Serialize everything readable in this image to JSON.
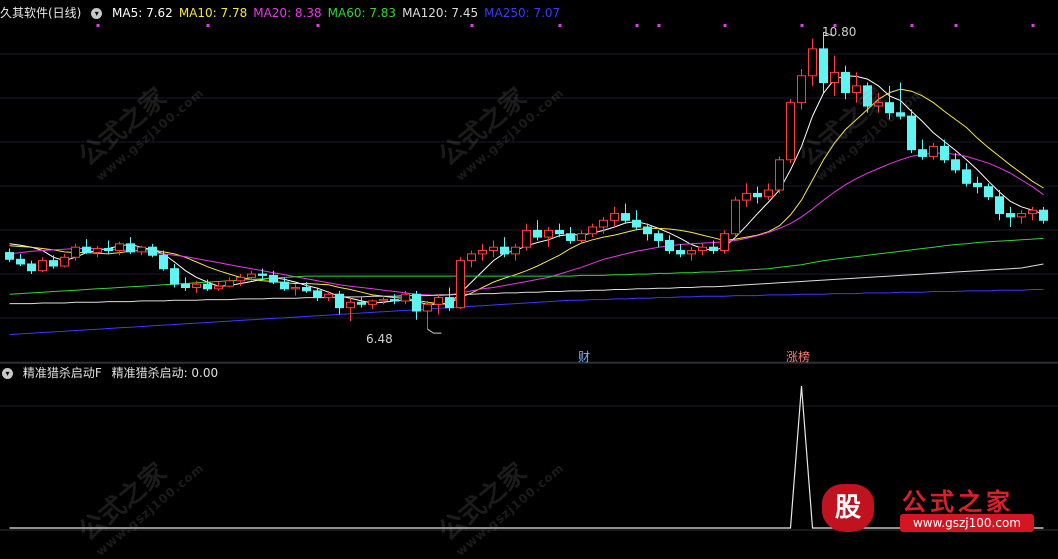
{
  "header": {
    "title": "久其软件(日线)",
    "ma": [
      {
        "label": "MA5: 7.62",
        "color": "#ffffff"
      },
      {
        "label": "MA10: 7.78",
        "color": "#f5e642"
      },
      {
        "label": "MA20: 8.38",
        "color": "#e83ae8"
      },
      {
        "label": "MA60: 7.83",
        "color": "#33d433"
      },
      {
        "label": "MA120: 7.45",
        "color": "#dcdcdc"
      },
      {
        "label": "MA250: 7.07",
        "color": "#3a3aff"
      }
    ]
  },
  "price_chart": {
    "high_label": "10.80",
    "low_label": "6.48",
    "markers": {
      "cai": "财",
      "zhangbang": "涨榜"
    },
    "up_color": "#ff3d3d",
    "down_color": "#5ff5f5"
  },
  "indicator": {
    "name": "精准猎杀启动F",
    "value_label": "精准猎杀启动: 0.00"
  },
  "watermark": {
    "text": "公式之家",
    "url": "www.gszj100.com"
  },
  "logo": {
    "char": "股",
    "title": "公式之家",
    "url": "www.gszj100.com"
  },
  "chart_data": {
    "type": "candlestick",
    "ohlc": [
      [
        7.62,
        7.68,
        7.48,
        7.52
      ],
      [
        7.52,
        7.6,
        7.42,
        7.45
      ],
      [
        7.45,
        7.5,
        7.3,
        7.35
      ],
      [
        7.35,
        7.55,
        7.33,
        7.5
      ],
      [
        7.5,
        7.58,
        7.38,
        7.42
      ],
      [
        7.42,
        7.6,
        7.4,
        7.55
      ],
      [
        7.55,
        7.75,
        7.5,
        7.7
      ],
      [
        7.7,
        7.82,
        7.6,
        7.62
      ],
      [
        7.62,
        7.72,
        7.55,
        7.68
      ],
      [
        7.68,
        7.8,
        7.6,
        7.65
      ],
      [
        7.65,
        7.78,
        7.58,
        7.75
      ],
      [
        7.75,
        7.85,
        7.6,
        7.63
      ],
      [
        7.63,
        7.72,
        7.58,
        7.7
      ],
      [
        7.7,
        7.75,
        7.55,
        7.58
      ],
      [
        7.58,
        7.65,
        7.35,
        7.38
      ],
      [
        7.38,
        7.45,
        7.1,
        7.15
      ],
      [
        7.15,
        7.25,
        7.05,
        7.1
      ],
      [
        7.1,
        7.2,
        7.02,
        7.15
      ],
      [
        7.15,
        7.22,
        7.05,
        7.08
      ],
      [
        7.08,
        7.18,
        7.05,
        7.12
      ],
      [
        7.12,
        7.25,
        7.1,
        7.2
      ],
      [
        7.2,
        7.3,
        7.12,
        7.25
      ],
      [
        7.25,
        7.35,
        7.2,
        7.3
      ],
      [
        7.3,
        7.38,
        7.22,
        7.28
      ],
      [
        7.28,
        7.35,
        7.15,
        7.18
      ],
      [
        7.18,
        7.25,
        7.05,
        7.08
      ],
      [
        7.08,
        7.15,
        6.98,
        7.1
      ],
      [
        7.1,
        7.18,
        7.02,
        7.05
      ],
      [
        7.05,
        7.1,
        6.9,
        6.95
      ],
      [
        6.95,
        7.05,
        6.9,
        7.0
      ],
      [
        7.0,
        7.05,
        6.7,
        6.8
      ],
      [
        6.8,
        6.95,
        6.6,
        6.88
      ],
      [
        6.88,
        6.95,
        6.8,
        6.85
      ],
      [
        6.85,
        6.92,
        6.78,
        6.9
      ],
      [
        6.9,
        6.98,
        6.85,
        6.92
      ],
      [
        6.92,
        7.0,
        6.85,
        6.9
      ],
      [
        6.9,
        7.05,
        6.85,
        7.0
      ],
      [
        7.0,
        7.05,
        6.62,
        6.75
      ],
      [
        6.75,
        6.9,
        6.48,
        6.85
      ],
      [
        6.85,
        7.0,
        6.7,
        6.95
      ],
      [
        6.95,
        7.1,
        6.75,
        6.8
      ],
      [
        6.8,
        7.55,
        6.78,
        7.5
      ],
      [
        7.5,
        7.65,
        7.4,
        7.6
      ],
      [
        7.6,
        7.75,
        7.5,
        7.65
      ],
      [
        7.65,
        7.8,
        7.55,
        7.7
      ],
      [
        7.7,
        7.85,
        7.55,
        7.6
      ],
      [
        7.6,
        7.75,
        7.5,
        7.7
      ],
      [
        7.7,
        8.05,
        7.65,
        7.95
      ],
      [
        7.95,
        8.1,
        7.8,
        7.85
      ],
      [
        7.85,
        8.0,
        7.7,
        7.95
      ],
      [
        7.95,
        8.05,
        7.85,
        7.9
      ],
      [
        7.9,
        8.0,
        7.75,
        7.8
      ],
      [
        7.8,
        7.95,
        7.75,
        7.9
      ],
      [
        7.9,
        8.05,
        7.85,
        8.0
      ],
      [
        8.0,
        8.15,
        7.9,
        8.1
      ],
      [
        8.1,
        8.3,
        8.0,
        8.2
      ],
      [
        8.2,
        8.35,
        8.05,
        8.1
      ],
      [
        8.1,
        8.25,
        7.95,
        8.0
      ],
      [
        8.0,
        8.05,
        7.8,
        7.9
      ],
      [
        7.9,
        7.95,
        7.7,
        7.8
      ],
      [
        7.8,
        7.88,
        7.6,
        7.65
      ],
      [
        7.65,
        7.75,
        7.55,
        7.6
      ],
      [
        7.6,
        7.7,
        7.5,
        7.65
      ],
      [
        7.65,
        7.75,
        7.58,
        7.7
      ],
      [
        7.7,
        7.8,
        7.6,
        7.65
      ],
      [
        7.65,
        7.95,
        7.6,
        7.9
      ],
      [
        7.9,
        8.45,
        7.85,
        8.4
      ],
      [
        8.4,
        8.65,
        8.3,
        8.5
      ],
      [
        8.5,
        8.6,
        8.35,
        8.45
      ],
      [
        8.45,
        8.65,
        8.4,
        8.55
      ],
      [
        8.55,
        9.05,
        8.5,
        9.0
      ],
      [
        9.0,
        9.9,
        8.95,
        9.85
      ],
      [
        9.85,
        10.35,
        9.75,
        10.25
      ],
      [
        10.25,
        10.8,
        10.1,
        10.65
      ],
      [
        10.65,
        10.9,
        10.0,
        10.15
      ],
      [
        10.15,
        10.55,
        9.95,
        10.3
      ],
      [
        10.3,
        10.4,
        9.9,
        10.0
      ],
      [
        10.0,
        10.3,
        9.85,
        10.1
      ],
      [
        10.1,
        10.15,
        9.7,
        9.8
      ],
      [
        9.8,
        10.0,
        9.7,
        9.85
      ],
      [
        9.85,
        10.1,
        9.6,
        9.7
      ],
      [
        9.7,
        10.15,
        9.6,
        9.65
      ],
      [
        9.65,
        9.75,
        9.1,
        9.15
      ],
      [
        9.15,
        9.3,
        9.0,
        9.05
      ],
      [
        9.05,
        9.25,
        9.0,
        9.2
      ],
      [
        9.2,
        9.3,
        8.95,
        9.0
      ],
      [
        9.0,
        9.1,
        8.8,
        8.85
      ],
      [
        8.85,
        8.95,
        8.6,
        8.65
      ],
      [
        8.65,
        8.75,
        8.5,
        8.6
      ],
      [
        8.6,
        8.65,
        8.4,
        8.45
      ],
      [
        8.45,
        8.55,
        8.1,
        8.2
      ],
      [
        8.2,
        8.3,
        8.0,
        8.15
      ],
      [
        8.15,
        8.25,
        8.05,
        8.2
      ],
      [
        8.2,
        8.3,
        8.1,
        8.25
      ],
      [
        8.25,
        8.3,
        8.05,
        8.1
      ]
    ],
    "series": [
      {
        "name": "MA5",
        "values": [
          7.75,
          7.73,
          7.7,
          7.65,
          7.55,
          7.5,
          7.55,
          7.62,
          7.65,
          7.68,
          7.72,
          7.74,
          7.7,
          7.66,
          7.6,
          7.48,
          7.35,
          7.25,
          7.18,
          7.12,
          7.13,
          7.16,
          7.19,
          7.22,
          7.25,
          7.22,
          7.18,
          7.13,
          7.09,
          7.03,
          6.97,
          6.94,
          6.9,
          6.87,
          6.88,
          6.9,
          6.92,
          6.89,
          6.85,
          6.85,
          6.86,
          7.02,
          7.18,
          7.34,
          7.5,
          7.61,
          7.65,
          7.72,
          7.77,
          7.81,
          7.87,
          7.89,
          7.88,
          7.91,
          7.95,
          8.0,
          8.06,
          8.08,
          8.04,
          7.98,
          7.91,
          7.83,
          7.74,
          7.68,
          7.65,
          7.7,
          7.85,
          8.02,
          8.2,
          8.37,
          8.55,
          8.85,
          9.2,
          9.65,
          9.99,
          10.2,
          10.25,
          10.24,
          10.2,
          10.1,
          9.95,
          9.88,
          9.72,
          9.57,
          9.4,
          9.27,
          9.14,
          9.0,
          8.85,
          8.68,
          8.52,
          8.38,
          8.3,
          8.25,
          8.19
        ]
      },
      {
        "name": "MA10",
        "values": [
          7.72,
          7.71,
          7.7,
          7.68,
          7.66,
          7.63,
          7.62,
          7.62,
          7.61,
          7.6,
          7.62,
          7.64,
          7.66,
          7.66,
          7.63,
          7.6,
          7.55,
          7.48,
          7.41,
          7.35,
          7.3,
          7.25,
          7.22,
          7.2,
          7.19,
          7.17,
          7.16,
          7.16,
          7.15,
          7.14,
          7.1,
          7.07,
          7.03,
          6.99,
          6.97,
          6.95,
          6.94,
          6.91,
          6.88,
          6.86,
          6.87,
          6.95,
          7.02,
          7.1,
          7.18,
          7.24,
          7.29,
          7.35,
          7.42,
          7.5,
          7.58,
          7.68,
          7.76,
          7.81,
          7.85,
          7.88,
          7.92,
          7.96,
          7.98,
          7.98,
          7.97,
          7.95,
          7.92,
          7.88,
          7.84,
          7.8,
          7.82,
          7.85,
          7.88,
          7.93,
          8.02,
          8.18,
          8.4,
          8.7,
          9.0,
          9.25,
          9.45,
          9.6,
          9.75,
          9.9,
          10.0,
          10.05,
          10.02,
          9.95,
          9.85,
          9.72,
          9.6,
          9.48,
          9.32,
          9.18,
          9.05,
          8.92,
          8.8,
          8.68,
          8.58
        ]
      },
      {
        "name": "MA20",
        "values": [
          7.6,
          7.62,
          7.64,
          7.65,
          7.66,
          7.67,
          7.68,
          7.68,
          7.68,
          7.67,
          7.66,
          7.65,
          7.64,
          7.62,
          7.6,
          7.58,
          7.56,
          7.53,
          7.5,
          7.47,
          7.44,
          7.41,
          7.38,
          7.35,
          7.32,
          7.29,
          7.26,
          7.23,
          7.2,
          7.17,
          7.14,
          7.12,
          7.1,
          7.08,
          7.06,
          7.04,
          7.02,
          7.0,
          6.99,
          6.98,
          6.99,
          7.02,
          7.05,
          7.08,
          7.1,
          7.13,
          7.16,
          7.19,
          7.22,
          7.25,
          7.3,
          7.35,
          7.4,
          7.46,
          7.52,
          7.56,
          7.6,
          7.64,
          7.67,
          7.7,
          7.72,
          7.74,
          7.75,
          7.76,
          7.77,
          7.78,
          7.8,
          7.83,
          7.87,
          7.92,
          7.98,
          8.05,
          8.15,
          8.27,
          8.4,
          8.52,
          8.63,
          8.72,
          8.8,
          8.87,
          8.94,
          9.0,
          9.05,
          9.08,
          9.1,
          9.1,
          9.08,
          9.05,
          9.0,
          8.95,
          8.88,
          8.8,
          8.7,
          8.6,
          8.48
        ]
      },
      {
        "name": "MA60",
        "values": [
          7.0,
          7.01,
          7.02,
          7.03,
          7.04,
          7.05,
          7.06,
          7.07,
          7.08,
          7.09,
          7.1,
          7.11,
          7.12,
          7.13,
          7.14,
          7.15,
          7.16,
          7.17,
          7.18,
          7.19,
          7.2,
          7.21,
          7.22,
          7.23,
          7.24,
          7.25,
          7.26,
          7.27,
          7.27,
          7.27,
          7.27,
          7.27,
          7.27,
          7.27,
          7.27,
          7.27,
          7.27,
          7.27,
          7.27,
          7.27,
          7.27,
          7.27,
          7.27,
          7.27,
          7.27,
          7.27,
          7.27,
          7.27,
          7.27,
          7.27,
          7.27,
          7.27,
          7.28,
          7.28,
          7.28,
          7.29,
          7.29,
          7.3,
          7.3,
          7.31,
          7.31,
          7.32,
          7.32,
          7.33,
          7.33,
          7.34,
          7.35,
          7.36,
          7.37,
          7.38,
          7.4,
          7.42,
          7.44,
          7.47,
          7.5,
          7.52,
          7.54,
          7.56,
          7.58,
          7.6,
          7.62,
          7.64,
          7.66,
          7.68,
          7.7,
          7.72,
          7.74,
          7.75,
          7.77,
          7.78,
          7.79,
          7.8,
          7.81,
          7.82,
          7.83
        ]
      },
      {
        "name": "MA120",
        "values": [
          6.86,
          6.86,
          6.86,
          6.87,
          6.87,
          6.87,
          6.88,
          6.88,
          6.88,
          6.89,
          6.89,
          6.89,
          6.9,
          6.9,
          6.9,
          6.91,
          6.91,
          6.91,
          6.92,
          6.92,
          6.92,
          6.93,
          6.93,
          6.93,
          6.94,
          6.94,
          6.94,
          6.95,
          6.95,
          6.95,
          6.96,
          6.96,
          6.96,
          6.97,
          6.97,
          6.97,
          6.98,
          6.98,
          6.98,
          6.99,
          6.99,
          7.0,
          7.0,
          7.01,
          7.01,
          7.02,
          7.02,
          7.03,
          7.03,
          7.04,
          7.04,
          7.05,
          7.05,
          7.06,
          7.06,
          7.07,
          7.07,
          7.08,
          7.08,
          7.09,
          7.09,
          7.1,
          7.1,
          7.11,
          7.11,
          7.12,
          7.13,
          7.14,
          7.15,
          7.16,
          7.17,
          7.18,
          7.19,
          7.2,
          7.21,
          7.22,
          7.23,
          7.24,
          7.25,
          7.26,
          7.27,
          7.28,
          7.29,
          7.3,
          7.31,
          7.32,
          7.33,
          7.34,
          7.35,
          7.36,
          7.37,
          7.38,
          7.39,
          7.42,
          7.45
        ]
      },
      {
        "name": "MA250",
        "values": [
          6.4,
          6.41,
          6.42,
          6.43,
          6.44,
          6.45,
          6.46,
          6.47,
          6.48,
          6.49,
          6.5,
          6.51,
          6.52,
          6.53,
          6.54,
          6.55,
          6.56,
          6.57,
          6.58,
          6.59,
          6.6,
          6.61,
          6.62,
          6.63,
          6.64,
          6.65,
          6.66,
          6.67,
          6.68,
          6.69,
          6.7,
          6.71,
          6.72,
          6.73,
          6.74,
          6.75,
          6.76,
          6.77,
          6.78,
          6.79,
          6.8,
          6.81,
          6.82,
          6.83,
          6.84,
          6.85,
          6.86,
          6.87,
          6.88,
          6.89,
          6.9,
          6.91,
          6.91,
          6.92,
          6.92,
          6.93,
          6.93,
          6.94,
          6.94,
          6.95,
          6.95,
          6.96,
          6.96,
          6.97,
          6.97,
          6.97,
          6.98,
          6.98,
          6.98,
          6.99,
          6.99,
          6.99,
          7.0,
          7.0,
          7.0,
          7.01,
          7.01,
          7.01,
          7.02,
          7.02,
          7.02,
          7.03,
          7.03,
          7.03,
          7.04,
          7.04,
          7.04,
          7.05,
          7.05,
          7.05,
          7.06,
          7.06,
          7.06,
          7.07,
          7.07
        ]
      }
    ],
    "ylim": [
      6.2,
      11.05
    ],
    "indicator_values": [
      0,
      0,
      0,
      0,
      0,
      0,
      0,
      0,
      0,
      0,
      0,
      0,
      0,
      0,
      0,
      0,
      0,
      0,
      0,
      0,
      0,
      0,
      0,
      0,
      0,
      0,
      0,
      0,
      0,
      0,
      0,
      0,
      0,
      0,
      0,
      0,
      0,
      0,
      0,
      0,
      0,
      0,
      0,
      0,
      0,
      0,
      0,
      0,
      0,
      0,
      0,
      0,
      0,
      0,
      0,
      0,
      0,
      0,
      0,
      0,
      0,
      0,
      0,
      0,
      0,
      0,
      0,
      0,
      0,
      0,
      0,
      0,
      1,
      0,
      0,
      0,
      0,
      0,
      0,
      0,
      0,
      0,
      0,
      0,
      0,
      0,
      0,
      0,
      0,
      0,
      0,
      0,
      0,
      0,
      0
    ],
    "signal_dots": [
      8,
      18,
      28,
      42,
      50,
      57,
      59,
      65,
      72,
      75,
      82,
      86,
      93
    ]
  }
}
